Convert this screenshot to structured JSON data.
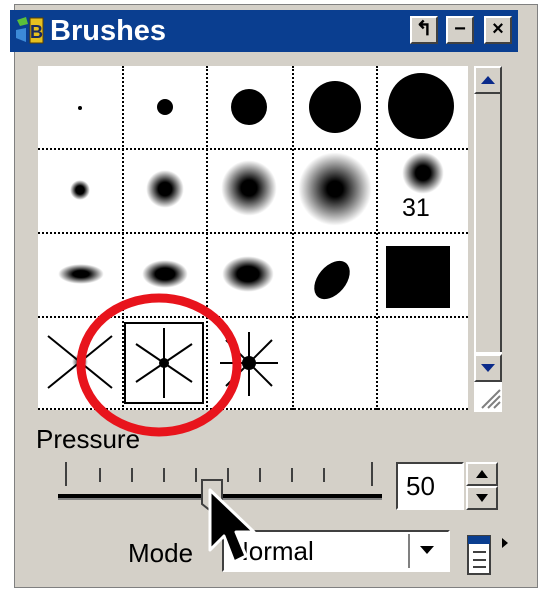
{
  "window": {
    "title": "Brushes"
  },
  "title_buttons": {
    "pin": "↰",
    "minimize": "−",
    "close": "×"
  },
  "brush_grid": {
    "size_label": "31"
  },
  "pressure": {
    "label": "Pressure",
    "value": "50",
    "slider_value_percent": 50
  },
  "mode": {
    "label": "Mode",
    "value": "Normal"
  },
  "colors": {
    "titlebar": "#0a3e90",
    "highlight": "#e8141c",
    "panel": "#d4d0c8"
  },
  "icons": [
    "brushes-app-icon",
    "pin-icon",
    "minimize-icon",
    "close-icon",
    "scroll-up-icon",
    "scroll-down-icon",
    "resize-grip-icon",
    "spin-up-icon",
    "spin-down-icon",
    "dropdown-arrow-icon",
    "brush-menu-icon",
    "mouse-cursor-icon"
  ]
}
